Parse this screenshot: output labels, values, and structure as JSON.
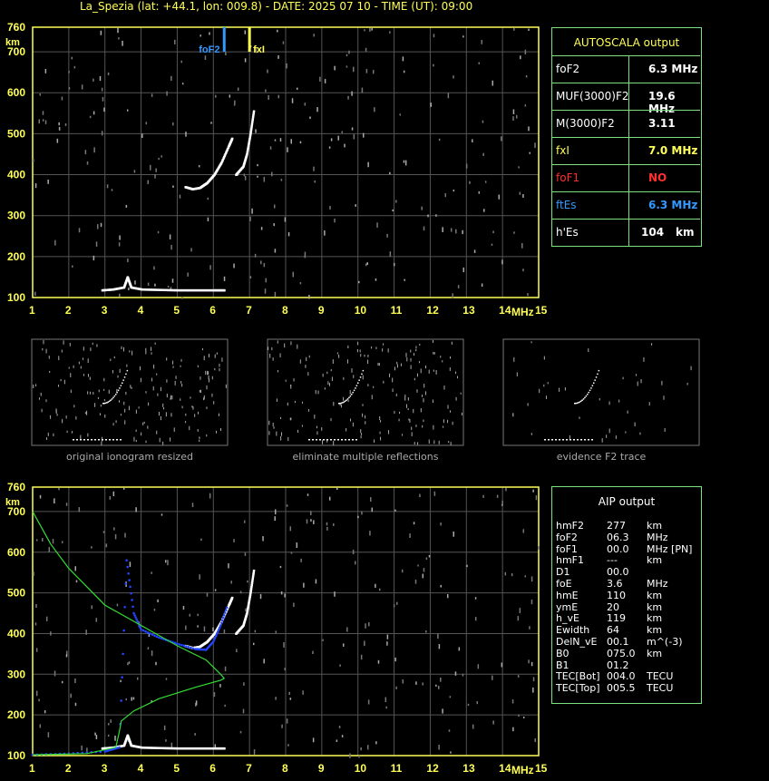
{
  "title": "La_Spezia (lat: +44.1, lon: 009.8) - DATE: 2025 07 10 - TIME (UT): 09:00",
  "colors": {
    "axis": "#ffff55",
    "grid": "#555555",
    "panel": "#7fe07f",
    "blue": "#3399ff",
    "red": "#ff3030",
    "yellow": "#ffff55",
    "green": "#33dd33",
    "trace": "#ffffff"
  },
  "chart_data": [
    {
      "type": "scatter",
      "name": "ionogram",
      "x_ticks": [
        "1",
        "2",
        "3",
        "4",
        "5",
        "6",
        "7",
        "8",
        "9",
        "10",
        "11",
        "12",
        "13",
        "14",
        "15"
      ],
      "y_ticks": [
        "100",
        "200",
        "300",
        "400",
        "500",
        "600",
        "700",
        "760"
      ],
      "xunit": "MHz",
      "yunit": "km",
      "xlim": [
        1,
        15
      ],
      "ylim": [
        100,
        760
      ],
      "grid": true,
      "markers": [
        {
          "label": "foF2",
          "value": 6.3,
          "color": "blue"
        },
        {
          "label": "fxI",
          "value": 7.0,
          "color": "yellow"
        }
      ],
      "traces": {
        "es_layer": [
          [
            2.9,
            118
          ],
          [
            3.2,
            120
          ],
          [
            3.5,
            125
          ],
          [
            3.6,
            150
          ],
          [
            3.7,
            125
          ],
          [
            4.0,
            120
          ],
          [
            4.5,
            119
          ],
          [
            5.0,
            118
          ],
          [
            5.5,
            118
          ],
          [
            6.0,
            118
          ],
          [
            6.3,
            118
          ]
        ],
        "f2_o": [
          [
            5.2,
            370
          ],
          [
            5.4,
            365
          ],
          [
            5.6,
            368
          ],
          [
            5.8,
            380
          ],
          [
            6.0,
            400
          ],
          [
            6.2,
            430
          ],
          [
            6.4,
            470
          ],
          [
            6.5,
            490
          ]
        ],
        "f2_x": [
          [
            6.6,
            400
          ],
          [
            6.8,
            420
          ],
          [
            6.9,
            450
          ],
          [
            7.0,
            500
          ],
          [
            7.1,
            560
          ]
        ]
      }
    },
    {
      "type": "line",
      "name": "aip",
      "x_ticks": [
        "1",
        "2",
        "3",
        "4",
        "5",
        "6",
        "7",
        "8",
        "9",
        "10",
        "11",
        "12",
        "13",
        "14",
        "15"
      ],
      "y_ticks": [
        "100",
        "200",
        "300",
        "400",
        "500",
        "600",
        "700",
        "760"
      ],
      "xunit": "MHz",
      "yunit": "km",
      "xlim": [
        1,
        15
      ],
      "ylim": [
        100,
        760
      ],
      "profile": [
        [
          1.0,
          700
        ],
        [
          1.5,
          620
        ],
        [
          2.0,
          560
        ],
        [
          3.0,
          470
        ],
        [
          4.0,
          420
        ],
        [
          5.0,
          370
        ],
        [
          5.8,
          335
        ],
        [
          6.2,
          300
        ],
        [
          6.3,
          290
        ],
        [
          6.2,
          285
        ],
        [
          5.5,
          268
        ],
        [
          4.5,
          240
        ],
        [
          3.8,
          210
        ],
        [
          3.45,
          185
        ],
        [
          3.4,
          160
        ],
        [
          3.3,
          120
        ],
        [
          2.5,
          105
        ],
        [
          1.0,
          102
        ]
      ],
      "fitted": [
        [
          1.0,
          102
        ],
        [
          2.0,
          105
        ],
        [
          3.0,
          110
        ],
        [
          3.4,
          120
        ],
        [
          3.6,
          580
        ],
        [
          3.8,
          450
        ],
        [
          4.0,
          410
        ],
        [
          4.5,
          390
        ],
        [
          5.0,
          375
        ],
        [
          5.5,
          362
        ],
        [
          5.8,
          360
        ],
        [
          6.0,
          380
        ],
        [
          6.2,
          420
        ],
        [
          6.4,
          470
        ]
      ]
    }
  ],
  "autoscala": {
    "header": "AUTOSCALA output",
    "rows": [
      {
        "label": "foF2",
        "value": "6.3 MHz",
        "color": "#ffffff"
      },
      {
        "label": "MUF(3000)F2",
        "value": "19.6 MHz",
        "color": "#ffffff"
      },
      {
        "label": "M(3000)F2",
        "value": "3.11",
        "color": "#ffffff"
      },
      {
        "label": "fxI",
        "value": "7.0 MHz",
        "color": "#ffff55"
      },
      {
        "label": "foF1",
        "value": "NO",
        "color": "#ff3030"
      },
      {
        "label": "ftEs",
        "value": "6.3 MHz",
        "color": "#3399ff"
      },
      {
        "label": "h'Es",
        "value": "104",
        "unit": "km",
        "color": "#ffffff"
      }
    ]
  },
  "thumbs": [
    {
      "caption": "original ionogram resized"
    },
    {
      "caption": "eliminate multiple reflections"
    },
    {
      "caption": "evidence F2 trace"
    }
  ],
  "aip": {
    "header": "AIP output",
    "rows": [
      [
        "hmF2",
        "277",
        "km"
      ],
      [
        "foF2",
        "06.3",
        "MHz"
      ],
      [
        "foF1",
        "00.0",
        "MHz   [PN]"
      ],
      [
        "hmF1",
        "---",
        "km"
      ],
      [
        "D1",
        "00.0",
        ""
      ],
      [
        "foE",
        "3.6",
        "MHz"
      ],
      [
        "hmE",
        "110",
        "km"
      ],
      [
        "ymE",
        "20",
        "km"
      ],
      [
        "h_vE",
        "119",
        "km"
      ],
      [
        "Ewidth",
        "64",
        "km"
      ],
      [
        "DelN_vE",
        "00.1",
        "m^(-3)"
      ],
      [
        "B0",
        "075.0",
        "km"
      ],
      [
        "B1",
        "01.2",
        ""
      ],
      [
        "TEC[Bot]",
        "004.0",
        "TECU"
      ],
      [
        "TEC[Top]",
        "005.5",
        "TECU"
      ]
    ]
  }
}
